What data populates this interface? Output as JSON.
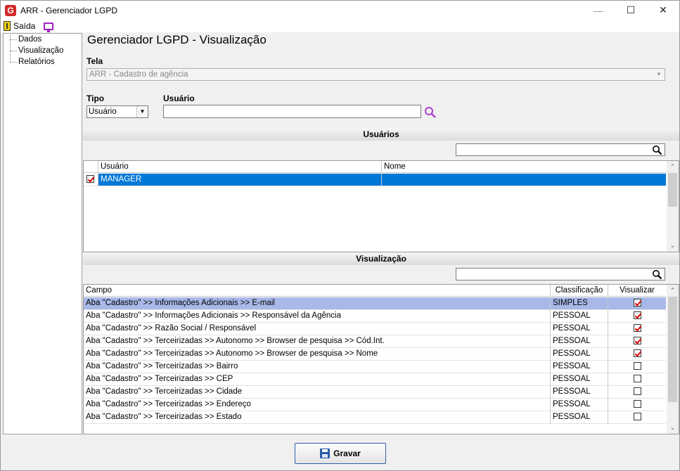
{
  "window": {
    "title": "ARR - Gerenciador LGPD",
    "logo": "G"
  },
  "menu": {
    "exit_label": "Saída"
  },
  "tree": {
    "items": [
      "Dados",
      "Visualização",
      "Relatórios"
    ]
  },
  "page": {
    "title": "Gerenciador LGPD - Visualização"
  },
  "tela": {
    "label": "Tela",
    "value": "ARR - Cadastro de agência"
  },
  "tipo": {
    "label": "Tipo",
    "value": "Usuário"
  },
  "usuario": {
    "label": "Usuário",
    "value": ""
  },
  "usuarios_section": {
    "title": "Usuários",
    "search_value": "",
    "columns": [
      "Usuário",
      "Nome"
    ],
    "rows": [
      {
        "checked": true,
        "usuario": "MANAGER",
        "nome": ""
      }
    ]
  },
  "visualizacao_section": {
    "title": "Visualização",
    "search_value": "",
    "columns": [
      "Campo",
      "Classificação",
      "Visualizar"
    ],
    "rows": [
      {
        "campo": "Aba \"Cadastro\" >> Informações Adicionais >> E-mail",
        "classificacao": "SIMPLES",
        "visualizar": true
      },
      {
        "campo": "Aba \"Cadastro\" >> Informações Adicionais >> Responsável da Agência",
        "classificacao": "PESSOAL",
        "visualizar": true
      },
      {
        "campo": "Aba \"Cadastro\" >> Razão Social / Responsável",
        "classificacao": "PESSOAL",
        "visualizar": true
      },
      {
        "campo": "Aba \"Cadastro\" >> Terceirizadas >> Autonomo >> Browser de pesquisa >> Cód.Int.",
        "classificacao": "PESSOAL",
        "visualizar": true
      },
      {
        "campo": "Aba \"Cadastro\" >> Terceirizadas >> Autonomo >> Browser de pesquisa >> Nome",
        "classificacao": "PESSOAL",
        "visualizar": true
      },
      {
        "campo": "Aba \"Cadastro\" >> Terceirizadas >> Bairro",
        "classificacao": "PESSOAL",
        "visualizar": false
      },
      {
        "campo": "Aba \"Cadastro\" >> Terceirizadas >> CEP",
        "classificacao": "PESSOAL",
        "visualizar": false
      },
      {
        "campo": "Aba \"Cadastro\" >> Terceirizadas >> Cidade",
        "classificacao": "PESSOAL",
        "visualizar": false
      },
      {
        "campo": "Aba \"Cadastro\" >> Terceirizadas >> Endereço",
        "classificacao": "PESSOAL",
        "visualizar": false
      },
      {
        "campo": "Aba \"Cadastro\" >> Terceirizadas >> Estado",
        "classificacao": "PESSOAL",
        "visualizar": false
      }
    ]
  },
  "footer": {
    "save_label": "Gravar"
  },
  "colors": {
    "selection": "#0078d7",
    "highlight": "#a8b8e8",
    "check": "#dd0000",
    "accent_purple": "#a020c0"
  }
}
